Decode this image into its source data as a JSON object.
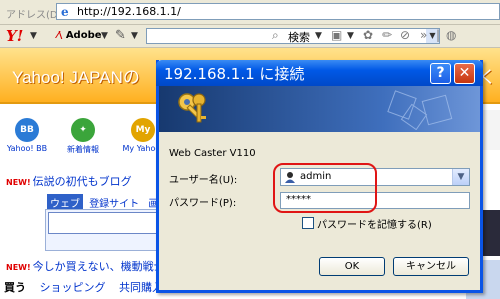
{
  "browser": {
    "address_label": "アドレス(D)",
    "url": "http://192.168.1.1/",
    "toolbar": {
      "logo": "Y!",
      "adobe_label": "Adobe",
      "search_button": "検索"
    }
  },
  "page": {
    "banner_text": "Yahoo! JAPANの",
    "banner_right": "すく",
    "services": [
      {
        "label": "Yahoo! BB",
        "icon_text": "BB",
        "color": "#2b7bd6"
      },
      {
        "label": "新着情報",
        "icon_text": "✦",
        "color": "#3ba53b"
      },
      {
        "label": "My Yahoo!",
        "icon_text": "My",
        "color": "#e2a400"
      }
    ],
    "news_badge": "NEW!",
    "news_text": "伝説の初代もブログ",
    "search_tabs": [
      "ウェブ",
      "登録サイト",
      "画像"
    ],
    "promo_badge": "NEW!",
    "promo_text": "今しか買えない、機動戦士ガ",
    "bottom_row": [
      "買う",
      "ショッピング",
      "共同購入"
    ]
  },
  "dialog": {
    "title": "192.168.1.1 に接続",
    "help_label": "?",
    "close_label": "✕",
    "realm": "Web Caster V110",
    "username_label": "ユーザー名(U):",
    "username_value": "admin",
    "password_label": "パスワード(P):",
    "password_value": "*****",
    "remember_label": "パスワードを記憶する(R)",
    "remember_checked": false,
    "ok_label": "OK",
    "cancel_label": "キャンセル"
  }
}
